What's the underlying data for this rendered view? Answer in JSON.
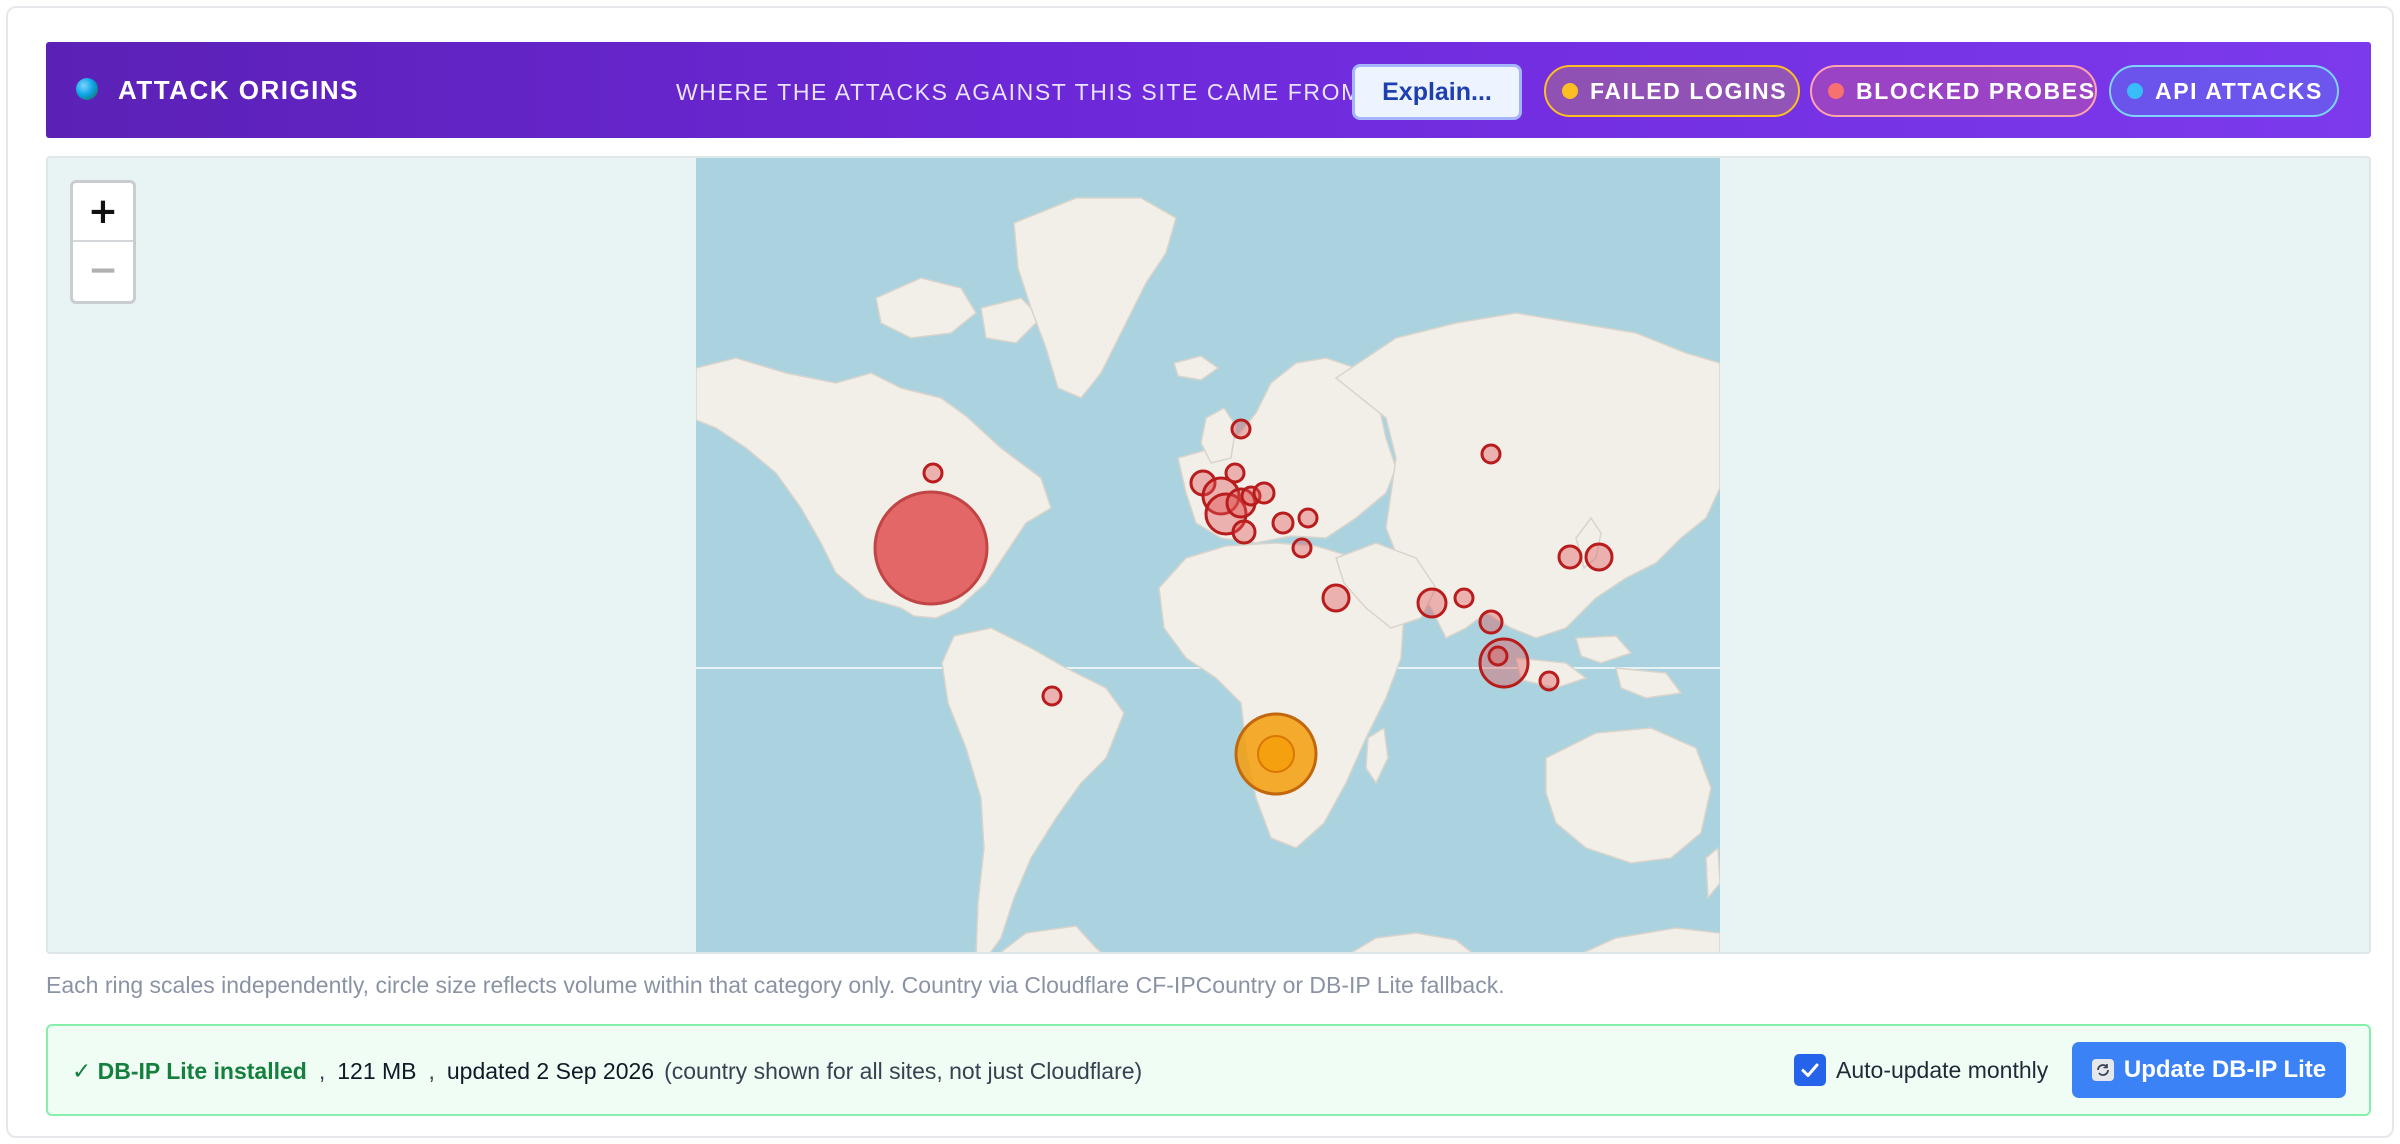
{
  "header": {
    "title": "ATTACK ORIGINS",
    "subtitle": "WHERE THE ATTACKS AGAINST THIS SITE CAME FROM",
    "explain_label": "Explain...",
    "icon": "globe-icon",
    "filters": [
      {
        "label": "FAILED LOGINS",
        "color": "#fbbf24"
      },
      {
        "label": "BLOCKED PROBES",
        "color": "#f87171"
      },
      {
        "label": "API ATTACKS",
        "color": "#38bdf8"
      }
    ]
  },
  "map": {
    "zoom_in": "+",
    "zoom_out": "−",
    "colors": {
      "ocean": "#aad3df",
      "land": "#f2efe9",
      "blocked": "#e05454",
      "failed": "#f59e0b"
    }
  },
  "note": "Each ring scales independently, circle size reflects volume within that category only. Country via Cloudflare CF-IPCountry or DB-IP Lite fallback.",
  "status": {
    "installed": "✓ DB-IP Lite installed",
    "sep": ",",
    "size": "121 MB",
    "updated": "updated 2 Sep 2026",
    "scope": "(country shown for all sites, not just Cloudflare)",
    "auto_update_label": "Auto-update monthly",
    "auto_update_checked": true,
    "update_button": "Update DB-IP Lite"
  }
}
